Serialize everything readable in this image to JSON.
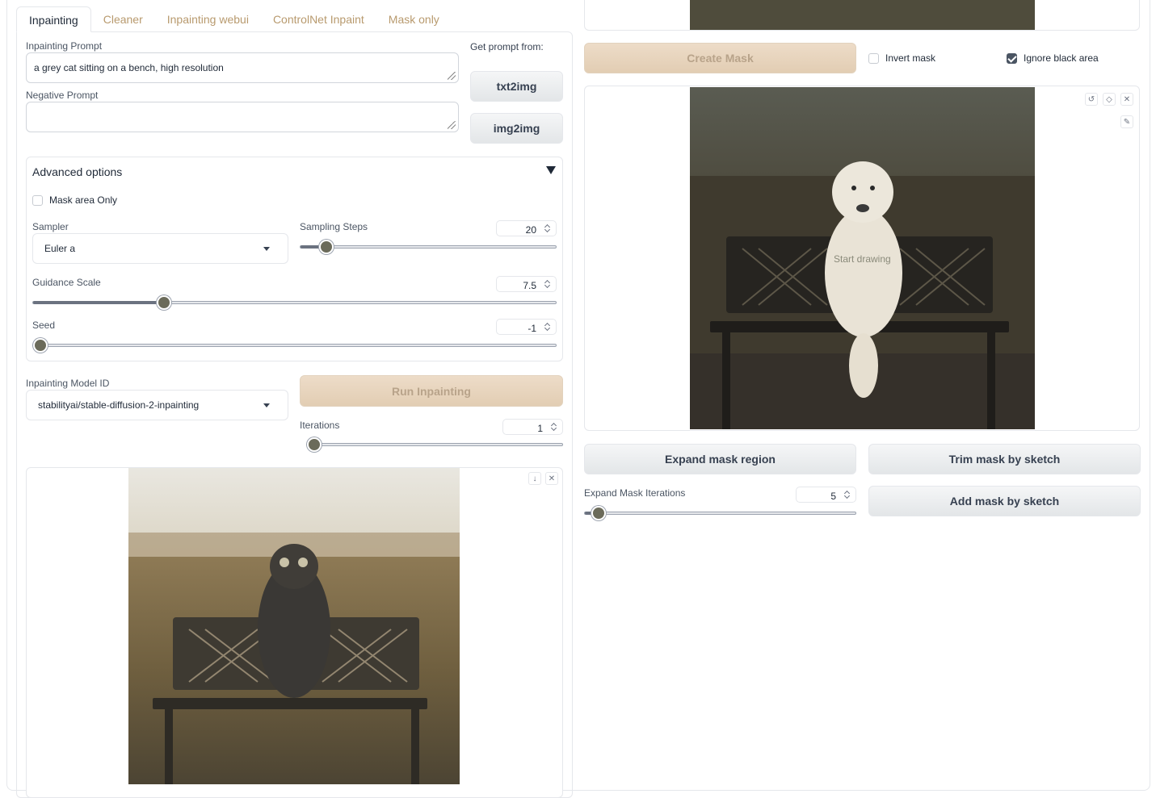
{
  "tabs": [
    "Inpainting",
    "Cleaner",
    "Inpainting webui",
    "ControlNet Inpaint",
    "Mask only"
  ],
  "prompt": {
    "label": "Inpainting Prompt",
    "value": "a grey cat sitting on a bench, high resolution",
    "negative_label": "Negative Prompt",
    "negative_value": "",
    "get_prompt_label": "Get prompt from:",
    "txt2img_button": "txt2img",
    "img2img_button": "img2img"
  },
  "advanced": {
    "title": "Advanced options",
    "toggle_icon": "triangle-down-icon",
    "mask_area_only_label": "Mask area Only",
    "mask_area_only_checked": false,
    "sampler_label": "Sampler",
    "sampler_value": "Euler a",
    "sampling_steps_label": "Sampling Steps",
    "sampling_steps_value": "20",
    "sampling_steps_fraction": 0.1,
    "guidance_label": "Guidance Scale",
    "guidance_value": "7.5",
    "guidance_fraction": 0.25,
    "seed_label": "Seed",
    "seed_value": "-1",
    "seed_fraction": 0.0
  },
  "model": {
    "label": "Inpainting Model ID",
    "value": "stabilityai/stable-diffusion-2-inpainting",
    "run_button": "Run Inpainting",
    "iterations_label": "Iterations",
    "iterations_value": "1",
    "iterations_fraction": 0.0
  },
  "right": {
    "create_mask_button": "Create Mask",
    "invert_mask_label": "Invert mask",
    "invert_mask_checked": false,
    "ignore_black_label": "Ignore black area",
    "ignore_black_checked": true,
    "sketch_hint": "Start drawing",
    "expand_mask_button": "Expand mask region",
    "trim_mask_button": "Trim mask by sketch",
    "add_mask_button": "Add mask by sketch",
    "expand_iter_label": "Expand Mask Iterations",
    "expand_iter_value": "5",
    "expand_iter_fraction": 0.05
  },
  "icons": {
    "undo": "undo-icon",
    "clear": "eraser-icon",
    "close": "close-icon",
    "brush": "brush-icon",
    "download": "download-icon"
  }
}
